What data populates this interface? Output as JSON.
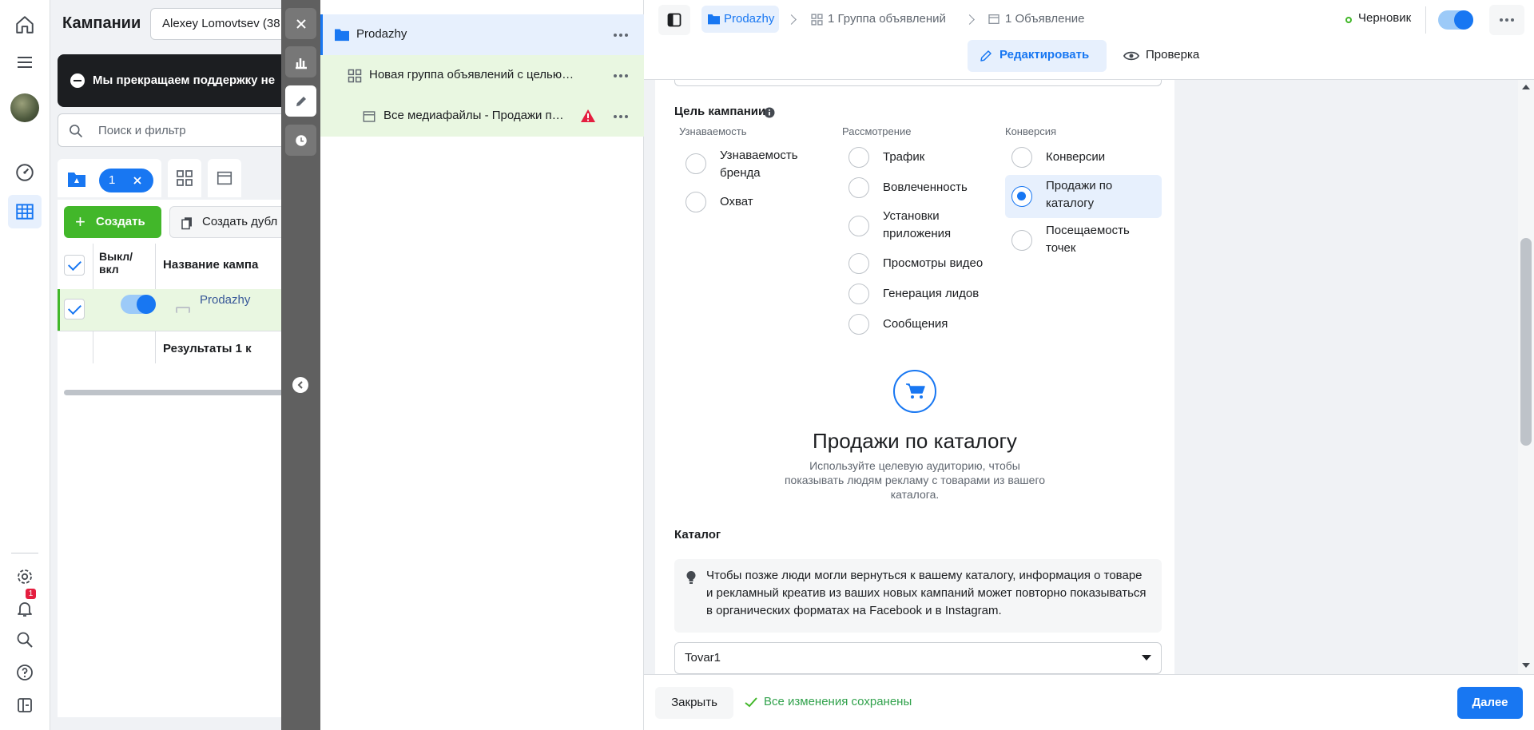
{
  "campaigns": {
    "title": "Кампании",
    "account": "Alexey Lomovtsev (38",
    "banner": "Мы прекращаем поддержку не",
    "search_placeholder": "Поиск и фильтр",
    "selected_count": "1",
    "create_label": "Создать",
    "duplicate_label": "Создать дубл",
    "col_onoff": "Выкл/ вкл",
    "col_name": "Название кампа",
    "row_name": "Prodazhy",
    "results": "Результаты 1 к"
  },
  "notifications": {
    "badge": "1"
  },
  "tree": {
    "campaign": "Prodazhy",
    "adset": "Новая группа объявлений с целью…",
    "ad": "Все медиафайлы - Продажи п…"
  },
  "header": {
    "crumbs": [
      "Prodazhy",
      "1 Группа объявлений",
      "1 Объявление"
    ],
    "status": "Черновик",
    "edit_label": "Редактировать",
    "review_label": "Проверка"
  },
  "objective": {
    "title": "Цель кампании",
    "columns": [
      {
        "heading": "Узнаваемость",
        "options": [
          "Узнаваемость бренда",
          "Охват"
        ]
      },
      {
        "heading": "Рассмотрение",
        "options": [
          "Трафик",
          "Вовлеченность",
          "Установки приложения",
          "Просмотры видео",
          "Генерация лидов",
          "Сообщения"
        ]
      },
      {
        "heading": "Конверсия",
        "options": [
          "Конверсии",
          "Продажи по каталогу",
          "Посещаемость точек"
        ]
      }
    ],
    "selected": "Продажи по каталогу"
  },
  "summary": {
    "title": "Продажи по каталогу",
    "description": "Используйте целевую аудиторию, чтобы показывать людям рекламу с товарами из вашего каталога."
  },
  "catalog": {
    "title": "Каталог",
    "info": "Чтобы позже люди могли вернуться к вашему каталогу, информация о товаре и рекламный креатив из ваших новых кампаний может повторно показываться в органических форматах на Facebook и в Instagram.",
    "selected": "Tovar1"
  },
  "footer": {
    "close_label": "Закрыть",
    "saved_text": "Все изменения сохранены",
    "next_label": "Далее"
  },
  "colors": {
    "primary": "#1877f2",
    "green": "#42b72a",
    "selected_bg": "#e7f0fd",
    "warning": "#e41e3f"
  }
}
